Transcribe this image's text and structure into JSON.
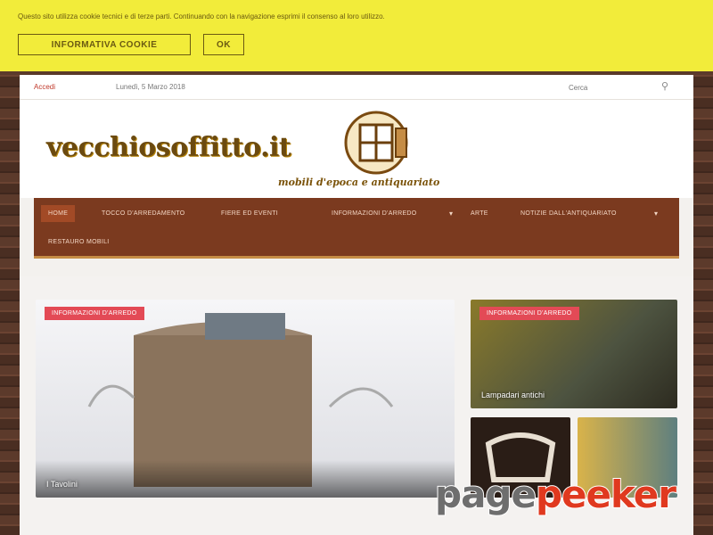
{
  "cookie": {
    "text": "Questo sito utilizza cookie tecnici e di terze parti. Continuando con la navigazione esprimi il consenso al loro utilizzo.",
    "info_label": "INFORMATIVA COOKIE",
    "ok_label": "OK"
  },
  "topbar": {
    "login": "Accedi",
    "date": "Lunedì, 5 Marzo 2018",
    "search_placeholder": "Cerca"
  },
  "header": {
    "logo": "vecchiosoffitto.it",
    "tagline": "mobili d'epoca e antiquariato"
  },
  "nav": {
    "items": [
      "HOME",
      "TOCCO D'ARREDAMENTO",
      "FIERE ED EVENTI",
      "INFORMAZIONI D'ARREDO",
      "ARTE",
      "NOTIZIE DALL'ANTIQUARIATO",
      "RESTAURO MOBILI"
    ]
  },
  "featured": {
    "big": {
      "category": "INFORMAZIONI D'ARREDO",
      "caption": "I Tavolini"
    },
    "side1": {
      "category": "INFORMAZIONI D'ARREDO",
      "caption": "Lampadari antichi"
    }
  },
  "watermark": {
    "part1": "page",
    "part2": "peeker"
  },
  "colors": {
    "cookie_bg": "#f2ec3a",
    "nav_bg": "#7b3a1f",
    "category_badge": "#e34a56",
    "accent": "#c0392b"
  }
}
